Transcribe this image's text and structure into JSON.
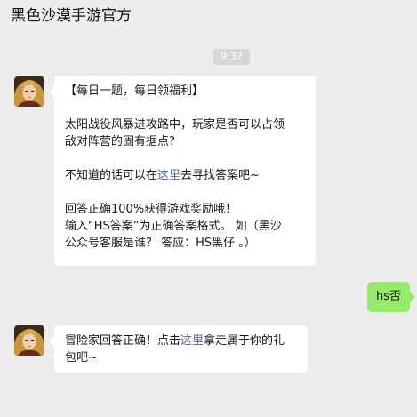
{
  "header": {
    "title": "黑色沙漠手游官方"
  },
  "chat": {
    "timestamp": "9:37",
    "message1": {
      "line1": "【每日一题，每日领福利】",
      "line2": "太阳战役风暴进攻路中，玩家是否可以占领",
      "line3": "敌对阵营的固有据点?",
      "line4_pre": "不知道的话可以在",
      "line4_link": "这里",
      "line4_post": "去寻找答案吧~",
      "line5": "回答正确100%获得游戏奖励哦！",
      "line6": "输入“HS答案”为正确答案格式。 如（黑沙",
      "line7": "公众号客服是谁？ 答应：HS黑仔 。）"
    },
    "message2": {
      "text": "hs否"
    },
    "message3": {
      "line1_pre": "冒险家回答正确！点击",
      "line1_link": "这里",
      "line1_post": "拿走属于你的礼",
      "line2": "包吧~"
    }
  },
  "colors": {
    "background": "#ededed",
    "bubble_incoming": "#ffffff",
    "bubble_outgoing": "#95ec69",
    "link": "#576b95",
    "timestamp_badge": "#d6d6d6"
  },
  "icons": {
    "header_menu": "more-dots-icon",
    "sender_avatar": "avatar-character-icon"
  }
}
